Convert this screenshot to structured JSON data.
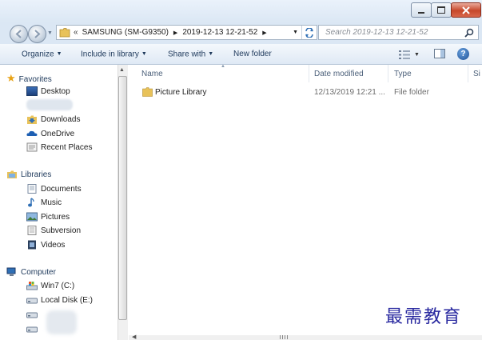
{
  "window": {
    "controls": {
      "minimize_icon": "minimize-icon",
      "maximize_icon": "maximize-icon",
      "close_icon": "close-icon"
    }
  },
  "address": {
    "overflow": "«",
    "segments": [
      "SAMSUNG (SM-G9350)",
      "2019-12-13 12-21-52"
    ],
    "search_placeholder": "Search 2019-12-13 12-21-52"
  },
  "toolbar": {
    "organize": "Organize",
    "include_in_library": "Include in library",
    "share_with": "Share with",
    "new_folder": "New folder"
  },
  "nav": {
    "favorites": {
      "label": "Favorites",
      "items": [
        {
          "label": "Desktop",
          "icon": "desktop-icon"
        },
        {
          "label": "",
          "icon": "blurred-item"
        },
        {
          "label": "Downloads",
          "icon": "downloads-icon"
        },
        {
          "label": "OneDrive",
          "icon": "onedrive-icon"
        },
        {
          "label": "Recent Places",
          "icon": "recent-places-icon"
        }
      ]
    },
    "libraries": {
      "label": "Libraries",
      "items": [
        {
          "label": "Documents",
          "icon": "documents-icon"
        },
        {
          "label": "Music",
          "icon": "music-icon"
        },
        {
          "label": "Pictures",
          "icon": "pictures-icon"
        },
        {
          "label": "Subversion",
          "icon": "subversion-icon"
        },
        {
          "label": "Videos",
          "icon": "videos-icon"
        }
      ]
    },
    "computer": {
      "label": "Computer",
      "items": [
        {
          "label": "Win7 (C:)",
          "icon": "system-drive-icon"
        },
        {
          "label": "Local Disk (E:)",
          "icon": "disk-drive-icon"
        },
        {
          "label": "",
          "icon": "disk-drive-icon"
        },
        {
          "label": "",
          "icon": "disk-drive-icon"
        }
      ]
    }
  },
  "table": {
    "columns": [
      "Name",
      "Date modified",
      "Type",
      "Si"
    ],
    "rows": [
      {
        "name": "Picture Library",
        "date": "12/13/2019 12:21 ...",
        "type": "File folder",
        "icon": "folder-icon"
      }
    ]
  },
  "watermark": "最需教育",
  "colors": {
    "accent": "#1e395b",
    "chrome": "#dbe7f4",
    "folder": "#e8c25a",
    "close": "#c6472a"
  }
}
